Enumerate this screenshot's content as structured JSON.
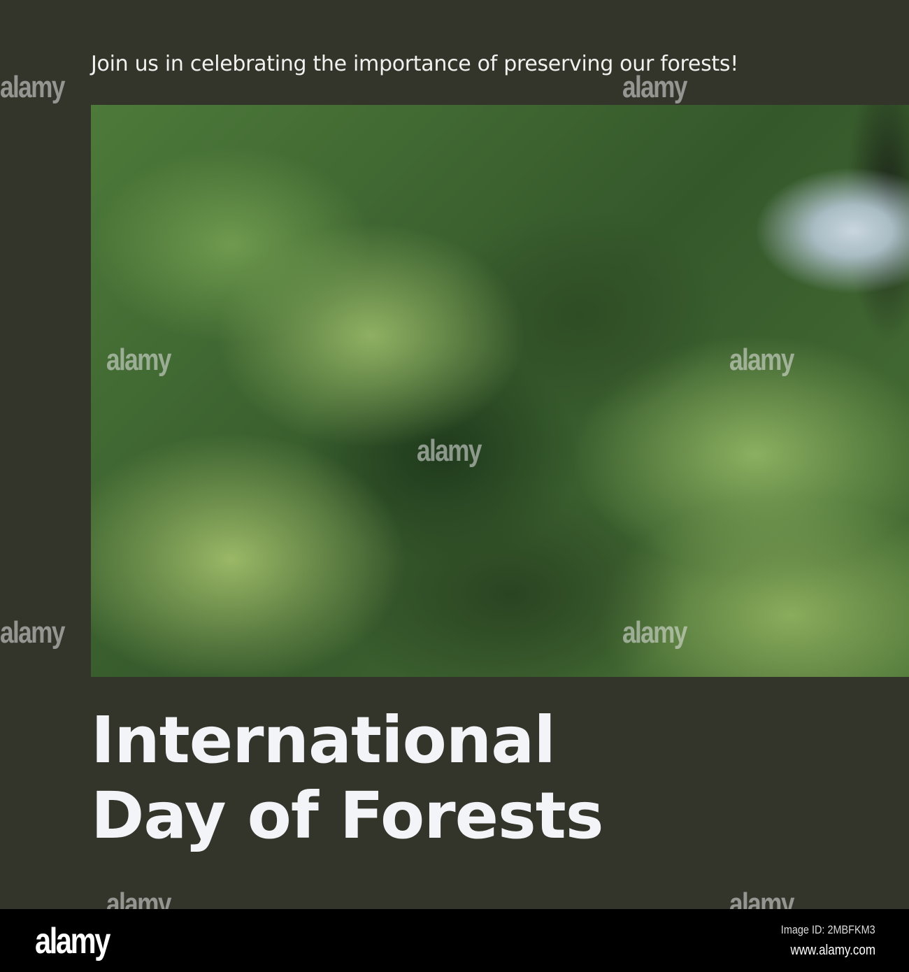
{
  "poster": {
    "tagline": "Join us in celebrating the importance of preserving our forests!",
    "headline_line1": "International",
    "headline_line2": "Day of Forests",
    "colors": {
      "background": "#33342a",
      "text": "#f3f4f7"
    }
  },
  "watermark": {
    "text": "alamy"
  },
  "footer": {
    "logo": "alamy",
    "image_id": "Image ID: 2MBFKM3",
    "url": "www.alamy.com"
  }
}
